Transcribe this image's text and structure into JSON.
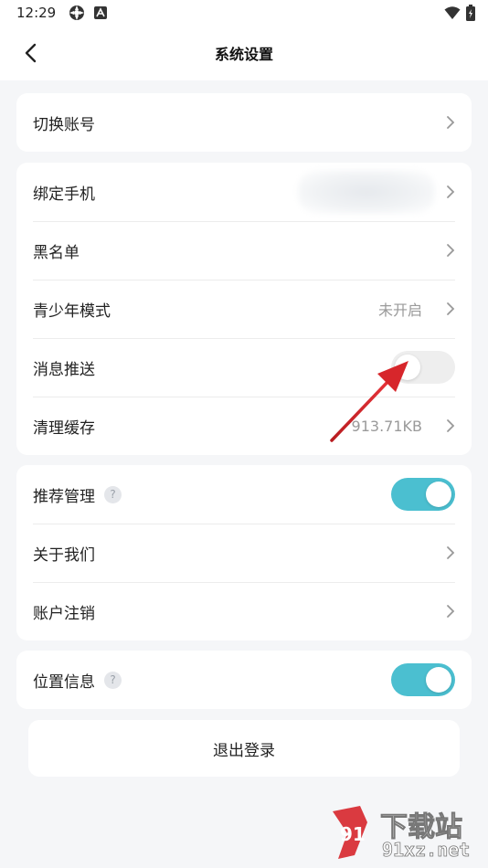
{
  "status_bar": {
    "time": "12:29"
  },
  "header": {
    "title": "系统设置"
  },
  "group1": {
    "switch_account": "切换账号"
  },
  "group2": {
    "bind_phone": "绑定手机",
    "blacklist": "黑名单",
    "teen_mode": "青少年模式",
    "teen_mode_value": "未开启",
    "message_push": "消息推送",
    "message_push_enabled": false,
    "clear_cache": "清理缓存",
    "cache_size": "913.71KB"
  },
  "group3": {
    "recommend_manage": "推荐管理",
    "recommend_enabled": true,
    "about_us": "关于我们",
    "account_cancel": "账户注销"
  },
  "group4": {
    "location_info": "位置信息",
    "location_enabled": true
  },
  "help_glyph": "?",
  "logout_label": "退出登录",
  "watermark": {
    "brand": "下载站",
    "site": "91xz.net"
  },
  "colors": {
    "toggle_on": "#4bbfd0",
    "toggle_off": "#eeeeee",
    "annotation_arrow": "#d7262b"
  }
}
